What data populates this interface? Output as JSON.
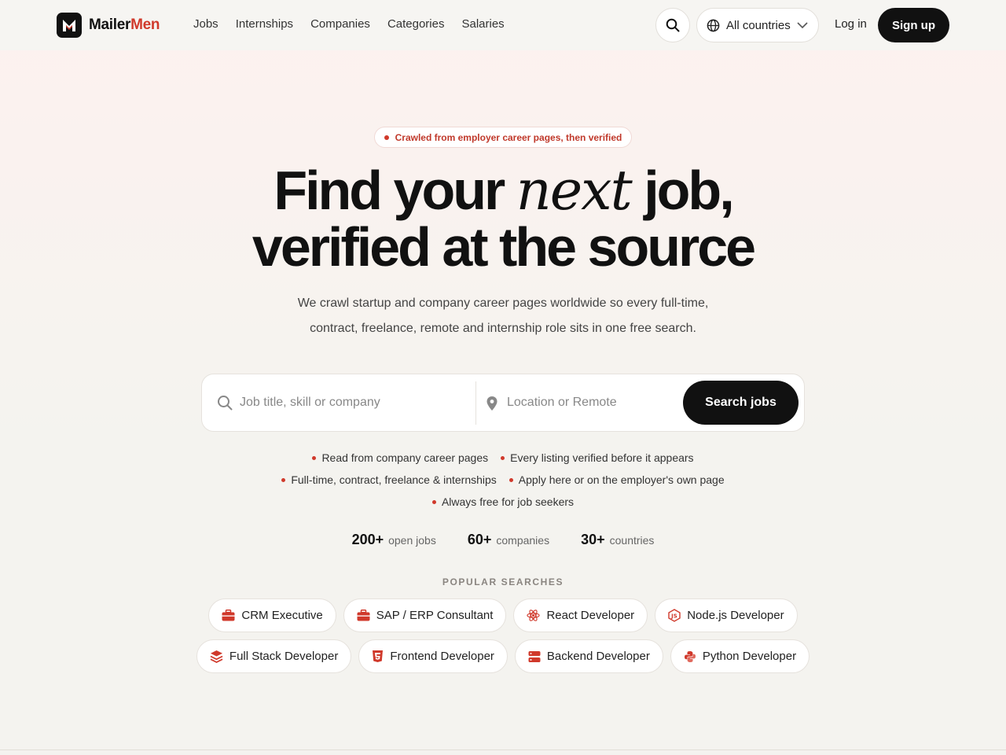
{
  "brand": {
    "name_main": "Mailer",
    "name_accent": "Men",
    "accent_color": "#d0392b"
  },
  "nav": {
    "links": [
      "Jobs",
      "Internships",
      "Companies",
      "Categories",
      "Salaries"
    ],
    "country_label": "All countries",
    "login_label": "Log in",
    "signup_label": "Sign up"
  },
  "hero": {
    "badge": "Crawled from employer career pages, then verified",
    "headline_part1": "Find your ",
    "headline_italic": "next",
    "headline_part2": " job,",
    "headline_line2": "verified at the source",
    "subtitle": "We crawl startup and company career pages worldwide so every full-time, contract, freelance, remote and internship role sits in one free search."
  },
  "search": {
    "query_placeholder": "Job title, skill or company",
    "location_placeholder": "Location or Remote",
    "button_label": "Search jobs"
  },
  "features": {
    "row1": [
      "Read from company career pages",
      "Every listing verified before it appears"
    ],
    "row2": [
      "Full-time, contract, freelance & internships",
      "Apply here or on the employer's own page"
    ],
    "row3": [
      "Always free for job seekers"
    ]
  },
  "stats": [
    {
      "num": "200+",
      "label": "open jobs"
    },
    {
      "num": "60+",
      "label": "companies"
    },
    {
      "num": "30+",
      "label": "countries"
    }
  ],
  "popular": {
    "title": "POPULAR SEARCHES",
    "row1": [
      {
        "label": "CRM Executive",
        "icon": "briefcase-icon"
      },
      {
        "label": "SAP / ERP Consultant",
        "icon": "briefcase-icon"
      },
      {
        "label": "React Developer",
        "icon": "react-icon"
      },
      {
        "label": "Node.js Developer",
        "icon": "nodejs-icon"
      }
    ],
    "row2": [
      {
        "label": "Full Stack Developer",
        "icon": "layers-icon"
      },
      {
        "label": "Frontend Developer",
        "icon": "html5-icon"
      },
      {
        "label": "Backend Developer",
        "icon": "server-icon"
      },
      {
        "label": "Python Developer",
        "icon": "python-icon"
      }
    ]
  }
}
